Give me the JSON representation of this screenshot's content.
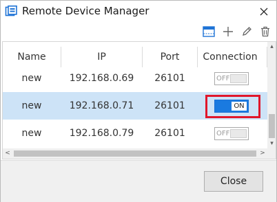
{
  "window": {
    "title": "Remote Device Manager",
    "app_icon": "device-manager-icon",
    "close_icon": "close-icon"
  },
  "toolbar": {
    "buttons": [
      {
        "icon": "device-list-icon"
      },
      {
        "icon": "add-icon"
      },
      {
        "icon": "edit-icon"
      },
      {
        "icon": "delete-icon"
      }
    ]
  },
  "table": {
    "columns": [
      "Name",
      "IP",
      "Port",
      "Connection"
    ],
    "rows": [
      {
        "name": "new",
        "ip": "192.168.0.69",
        "port": "26101",
        "connection": "OFF",
        "selected": false
      },
      {
        "name": "new",
        "ip": "192.168.0.71",
        "port": "26101",
        "connection": "ON",
        "selected": true
      },
      {
        "name": "new",
        "ip": "192.168.0.79",
        "port": "26101",
        "connection": "OFF",
        "selected": false
      }
    ]
  },
  "scroll_arrows": {
    "up": "▴",
    "down": "▾",
    "left": "<",
    "right": ">"
  },
  "footer": {
    "close_label": "Close"
  },
  "colors": {
    "selection": "#cde3f7",
    "toggle_on": "#1a7ae0",
    "highlight": "#e0162b",
    "app_icon": "#1e73d6"
  }
}
